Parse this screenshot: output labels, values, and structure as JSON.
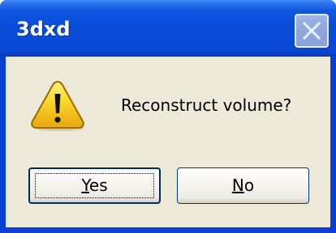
{
  "dialog": {
    "title": "3dxd",
    "message": "Reconstruct volume?",
    "icon": "warning-icon",
    "buttons": {
      "yes": {
        "mnemonic": "Y",
        "rest": "es"
      },
      "no": {
        "mnemonic": "N",
        "rest": "o"
      }
    },
    "close_icon": "close-icon"
  },
  "colors": {
    "titlebar": "#0a4cd9",
    "dialog_background": "#ece9d8",
    "warning_yellow": "#f5cf1f",
    "button_border": "#003c74"
  }
}
